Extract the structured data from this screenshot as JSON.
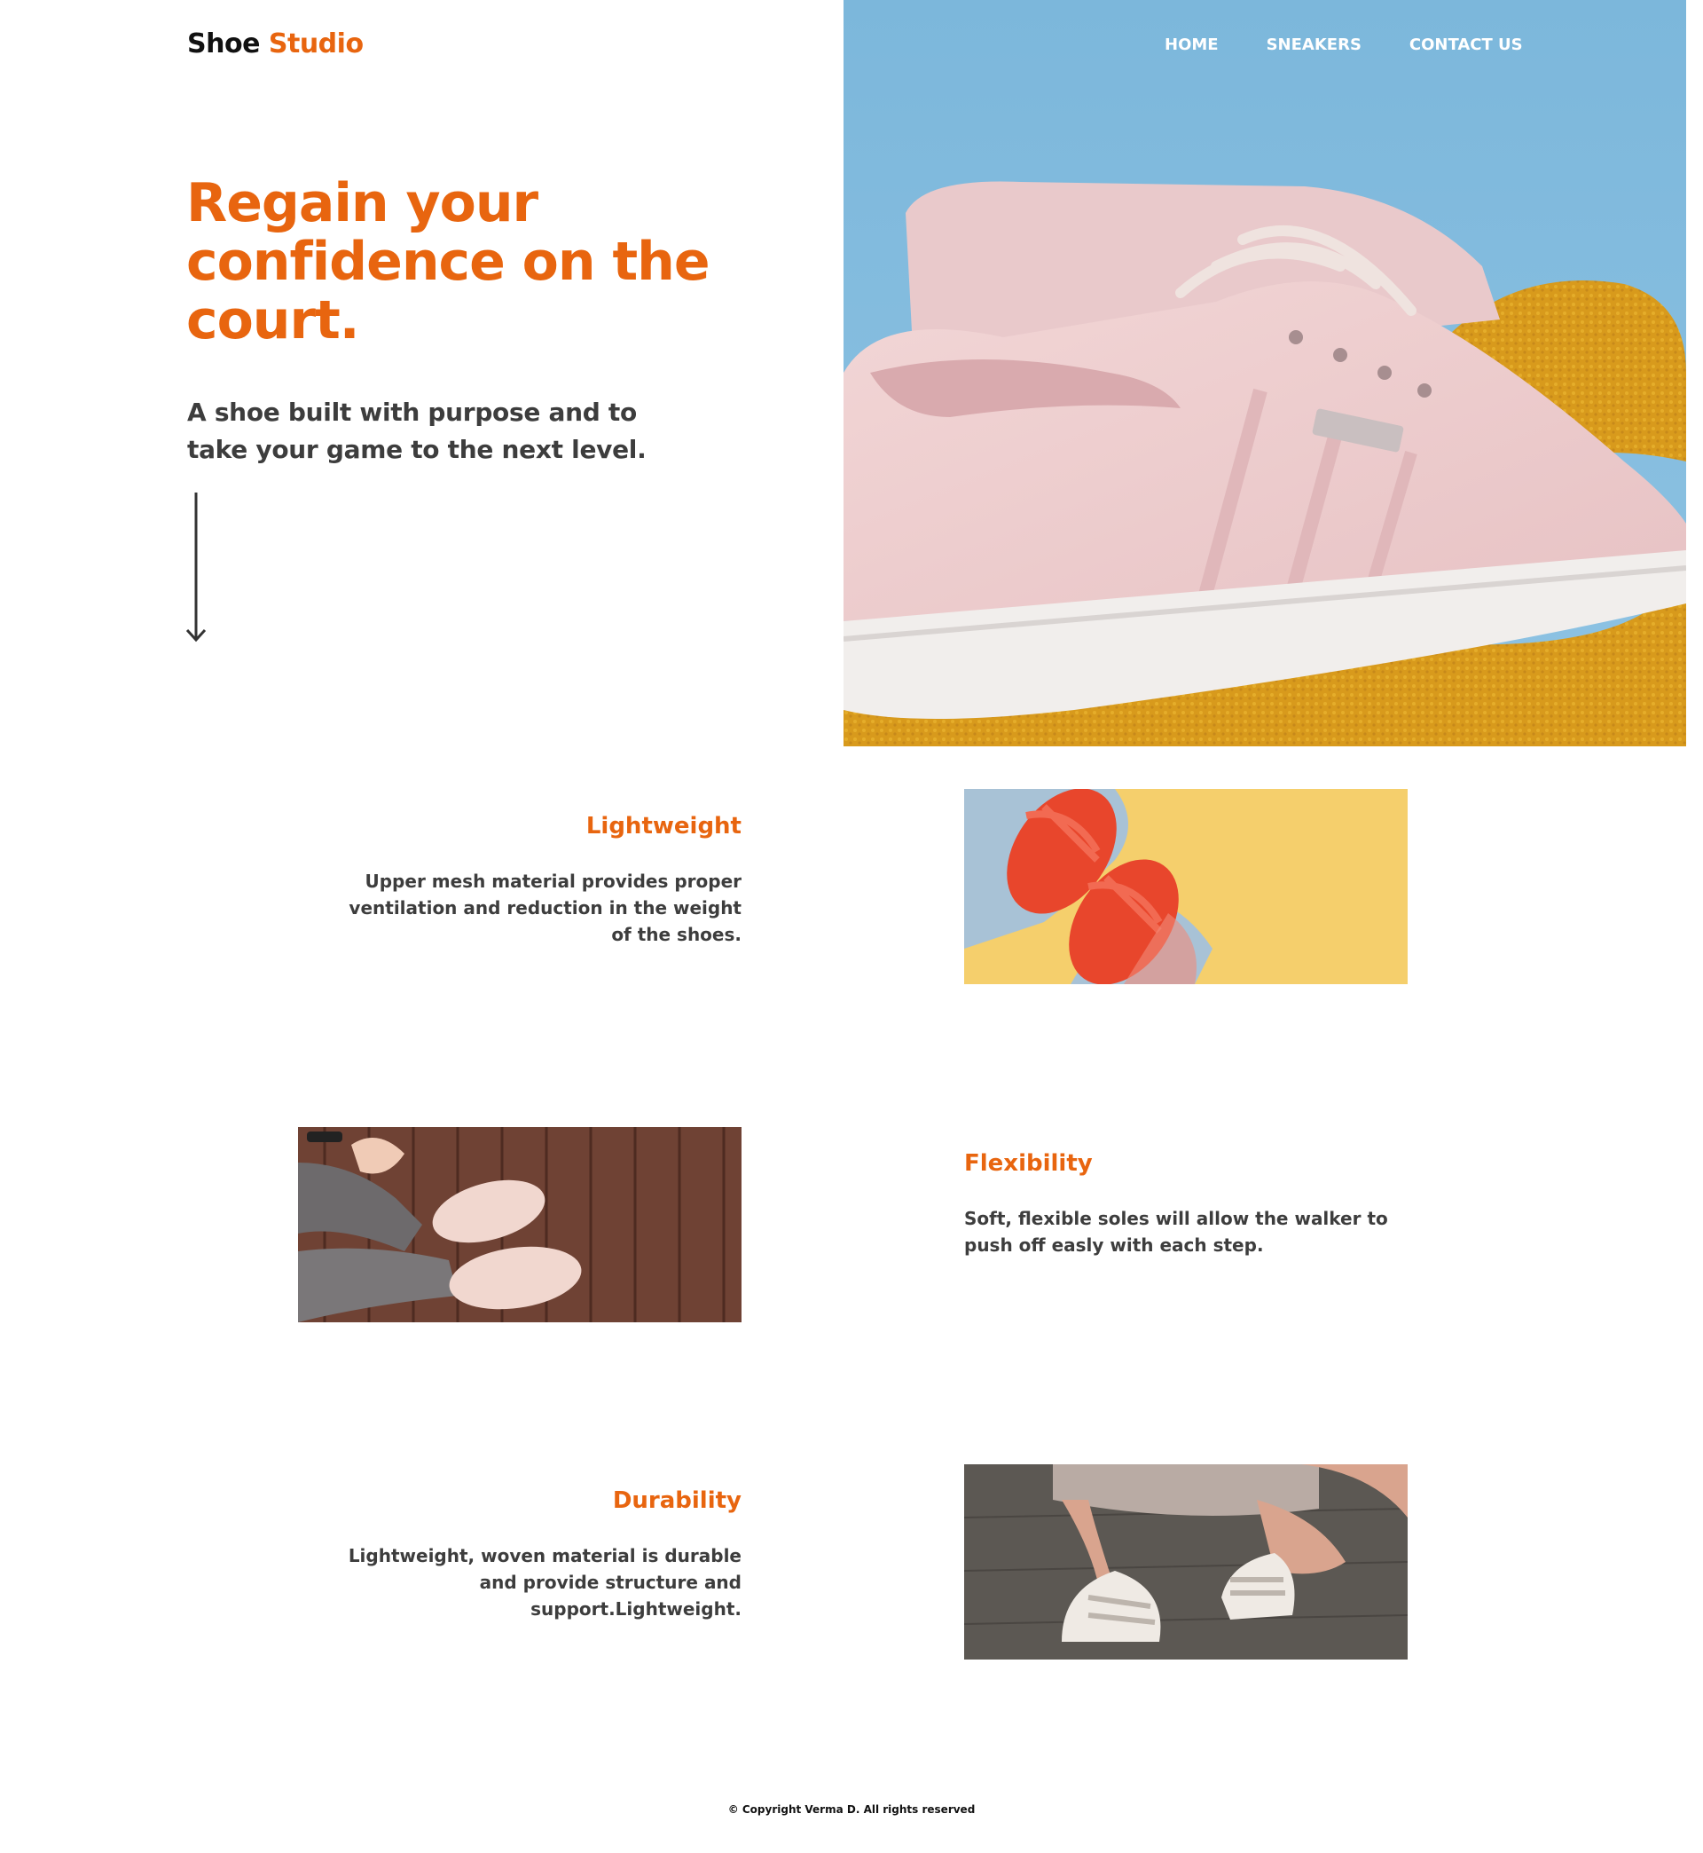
{
  "brand": {
    "name_part1": "Shoe",
    "name_part2": "Studio",
    "accent_color": "#e8650f"
  },
  "nav": {
    "items": [
      {
        "label": "HOME"
      },
      {
        "label": "SNEAKERS"
      },
      {
        "label": "CONTACT US"
      }
    ]
  },
  "hero": {
    "title": "Regain your confidence on the court.",
    "subtitle": "A shoe built with purpose and to take your game to the next level.",
    "arrow_icon": "arrow-down-icon"
  },
  "features": [
    {
      "title": "Lightweight",
      "text": "Upper mesh material provides proper ventilation and reduction in the weight of the shoes."
    },
    {
      "title": "Flexibility",
      "text": "Soft, flexible soles will allow the walker to push off easly with each step."
    },
    {
      "title": "Durability",
      "text": "Lightweight, woven material is durable and provide structure and support.Lightweight."
    }
  ],
  "footer": {
    "copyright": "© Copyright Verma D. All rights reserved"
  }
}
